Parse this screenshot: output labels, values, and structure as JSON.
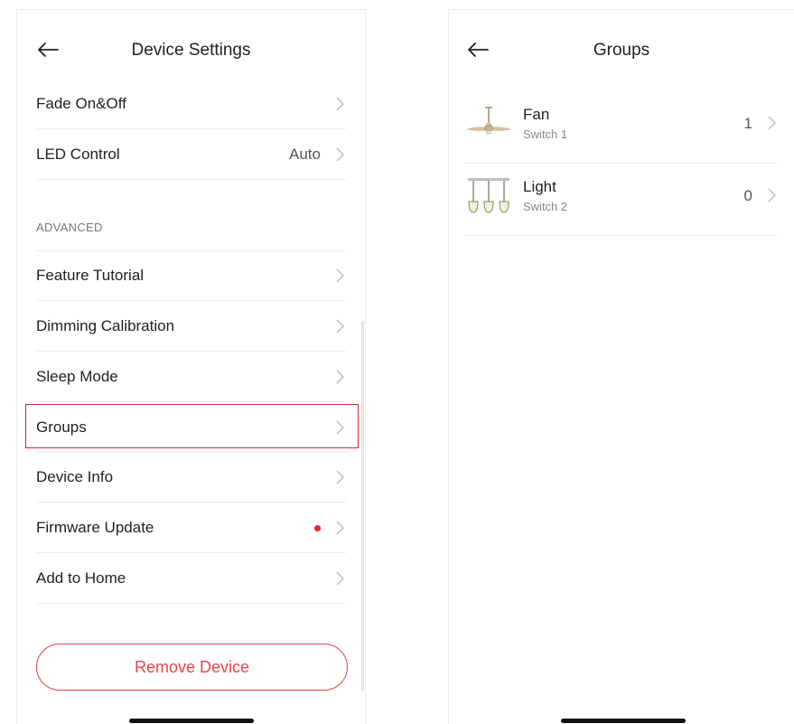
{
  "device_settings": {
    "title": "Device Settings",
    "rows_top": [
      {
        "label": "Fade On&Off",
        "value": ""
      },
      {
        "label": "LED Control",
        "value": "Auto"
      }
    ],
    "section_header": "ADVANCED",
    "rows_advanced": [
      {
        "label": "Feature Tutorial"
      },
      {
        "label": "Dimming Calibration"
      },
      {
        "label": "Sleep Mode"
      },
      {
        "label": "Groups"
      },
      {
        "label": "Device Info"
      },
      {
        "label": "Firmware Update"
      },
      {
        "label": "Add to Home"
      }
    ],
    "remove_label": "Remove Device",
    "accent_color": "#e8434a"
  },
  "groups_screen": {
    "title": "Groups",
    "items": [
      {
        "name": "Fan",
        "subtitle": "Switch 1",
        "count": "1",
        "icon": "ceiling-fan-icon"
      },
      {
        "name": "Light",
        "subtitle": "Switch 2",
        "count": "0",
        "icon": "pendant-lights-icon"
      }
    ]
  }
}
